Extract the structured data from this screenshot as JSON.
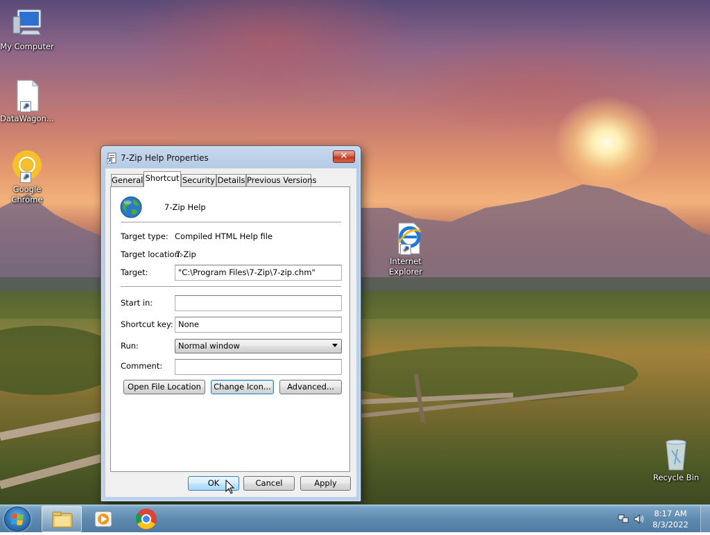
{
  "desktop": {
    "icons": [
      {
        "label": "My Computer",
        "icon": "computer-icon"
      },
      {
        "label": "DataWagon...",
        "icon": "document-shortcut-icon"
      },
      {
        "label": "Google Chrome",
        "icon": "chrome-icon"
      },
      {
        "label": "Internet Explorer",
        "icon": "internet-explorer-icon"
      },
      {
        "label": "Recycle Bin",
        "icon": "recycle-bin-icon"
      }
    ]
  },
  "dialog": {
    "title": "7-Zip Help Properties",
    "close_label": "✕",
    "tabs": [
      {
        "label": "General",
        "active": false
      },
      {
        "label": "Shortcut",
        "active": true
      },
      {
        "label": "Security",
        "active": false
      },
      {
        "label": "Details",
        "active": false
      },
      {
        "label": "Previous Versions",
        "active": false
      }
    ],
    "app_name": "7-Zip Help",
    "target_type": {
      "label": "Target type:",
      "value": "Compiled HTML Help file"
    },
    "target_location": {
      "label": "Target location:",
      "value": "7-Zip"
    },
    "target": {
      "label": "Target:",
      "value": "\"C:\\Program Files\\7-Zip\\7-zip.chm\""
    },
    "start_in": {
      "label": "Start in:",
      "value": ""
    },
    "shortcut_key": {
      "label": "Shortcut key:",
      "value": "None"
    },
    "run": {
      "label": "Run:",
      "value": "Normal window"
    },
    "comment": {
      "label": "Comment:",
      "value": ""
    },
    "buttons": {
      "open_file_location": "Open File Location",
      "change_icon": "Change Icon...",
      "advanced": "Advanced...",
      "ok": "OK",
      "cancel": "Cancel",
      "apply": "Apply"
    }
  },
  "taskbar": {
    "pinned": [
      "file-explorer-icon",
      "media-player-icon",
      "chrome-icon"
    ],
    "clock": {
      "time": "8:17 AM",
      "date": "8/3/2022"
    }
  }
}
